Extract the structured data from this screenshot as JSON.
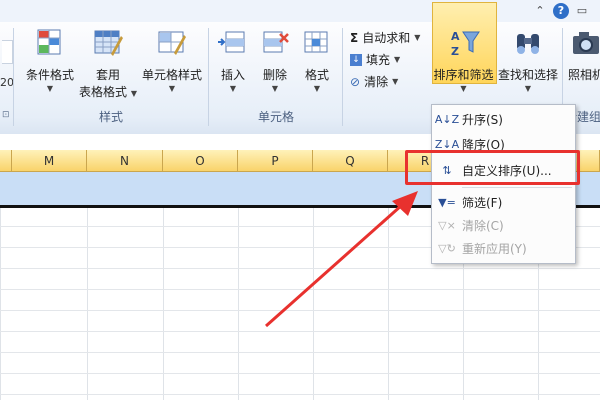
{
  "ribbon": {
    "styles_group": {
      "label": "样式",
      "conditional_format": "条件格式",
      "table_format_line1": "套用",
      "table_format_line2": "表格格式",
      "cell_styles": "单元格样式"
    },
    "cells_group": {
      "label": "单元格",
      "insert": "插入",
      "delete": "删除",
      "format": "格式"
    },
    "editing_group": {
      "autosum": "自动求和",
      "fill": "填充",
      "clear": "清除",
      "sort_filter": "排序和筛选",
      "find_select": "查找和选择"
    },
    "extra_group": {
      "photo": "照相机",
      "new_group_partial": "新建组"
    },
    "left_partial_label": "20"
  },
  "columns": [
    "M",
    "N",
    "O",
    "P",
    "Q",
    "R"
  ],
  "sort_menu": {
    "items": [
      {
        "label": "升序(S)",
        "icon": "sort-ascending-icon",
        "enabled": true
      },
      {
        "label": "降序(O)",
        "icon": "sort-descending-icon",
        "enabled": true
      },
      {
        "label": "自定义排序(U)...",
        "icon": "custom-sort-icon",
        "enabled": true
      },
      {
        "label": "筛选(F)",
        "icon": "filter-icon",
        "enabled": true
      },
      {
        "label": "清除(C)",
        "icon": "clear-filter-icon",
        "enabled": false
      },
      {
        "label": "重新应用(Y)",
        "icon": "reapply-icon",
        "enabled": false
      }
    ]
  },
  "colors": {
    "highlight": "#e8312e",
    "selected_row": "#c9def6",
    "active_button": "#ffd55a"
  }
}
